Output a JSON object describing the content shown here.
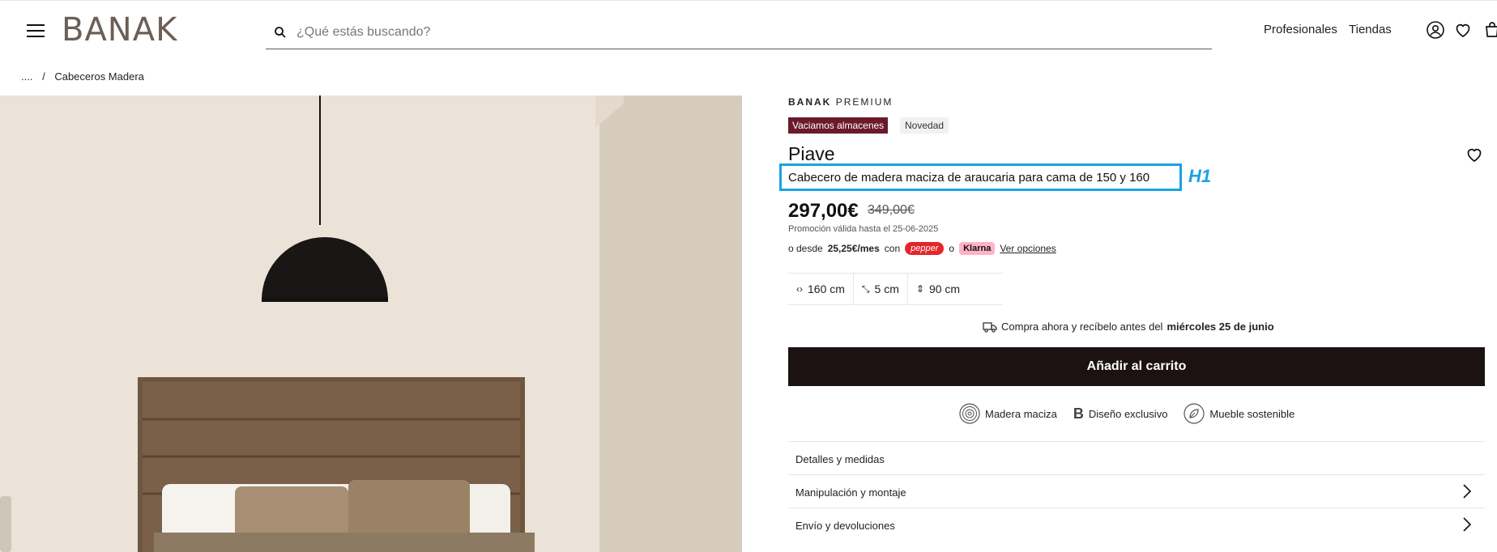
{
  "header": {
    "logo": "BANAK",
    "search_placeholder": "¿Qué estás buscando?",
    "nav": [
      "Profesionales",
      "Tiendas"
    ]
  },
  "breadcrumb": {
    "ellipsis": "....",
    "separator": "/",
    "current": "Cabeceros Madera"
  },
  "product": {
    "brand_bold": "BANAK",
    "brand_light": "PREMIUM",
    "badges": [
      "Vaciamos almacenes",
      "Novedad"
    ],
    "name": "Piave",
    "subtitle": "Cabecero de madera maciza de araucaria para cama de 150 y 160",
    "annotation_tag": "H1",
    "price": "297,00€",
    "old_price": "349,00€",
    "promo": "Promoción válida hasta el 25-06-2025",
    "finance": {
      "prefix": "o desde",
      "monthly": "25,25€/mes",
      "with": "con",
      "pepper": "pepper",
      "or": "o",
      "klarna": "Klarna",
      "link": "Ver opciones"
    },
    "dimensions": [
      {
        "icon": "width-arrows-icon",
        "symbol": "‹›",
        "value": "160 cm"
      },
      {
        "icon": "depth-arrows-icon",
        "symbol": "⤡",
        "value": "5 cm"
      },
      {
        "icon": "height-arrows-icon",
        "symbol": "⇕",
        "value": "90 cm"
      }
    ],
    "delivery": {
      "text": "Compra ahora y recíbelo antes del",
      "date": "miércoles 25 de junio"
    },
    "cart_button": "Añadir al carrito",
    "features": [
      "Madera maciza",
      "Diseño exclusivo",
      "Mueble sostenible"
    ],
    "accordion": [
      "Detalles y medidas",
      "Manipulación y montaje",
      "Envío y devoluciones"
    ]
  },
  "colors": {
    "badge_sale": "#6b1a2c",
    "cart_button": "#1c1212",
    "annotation": "#1aa3e0",
    "pepper": "#e4262a",
    "klarna": "#ffb3c7"
  }
}
